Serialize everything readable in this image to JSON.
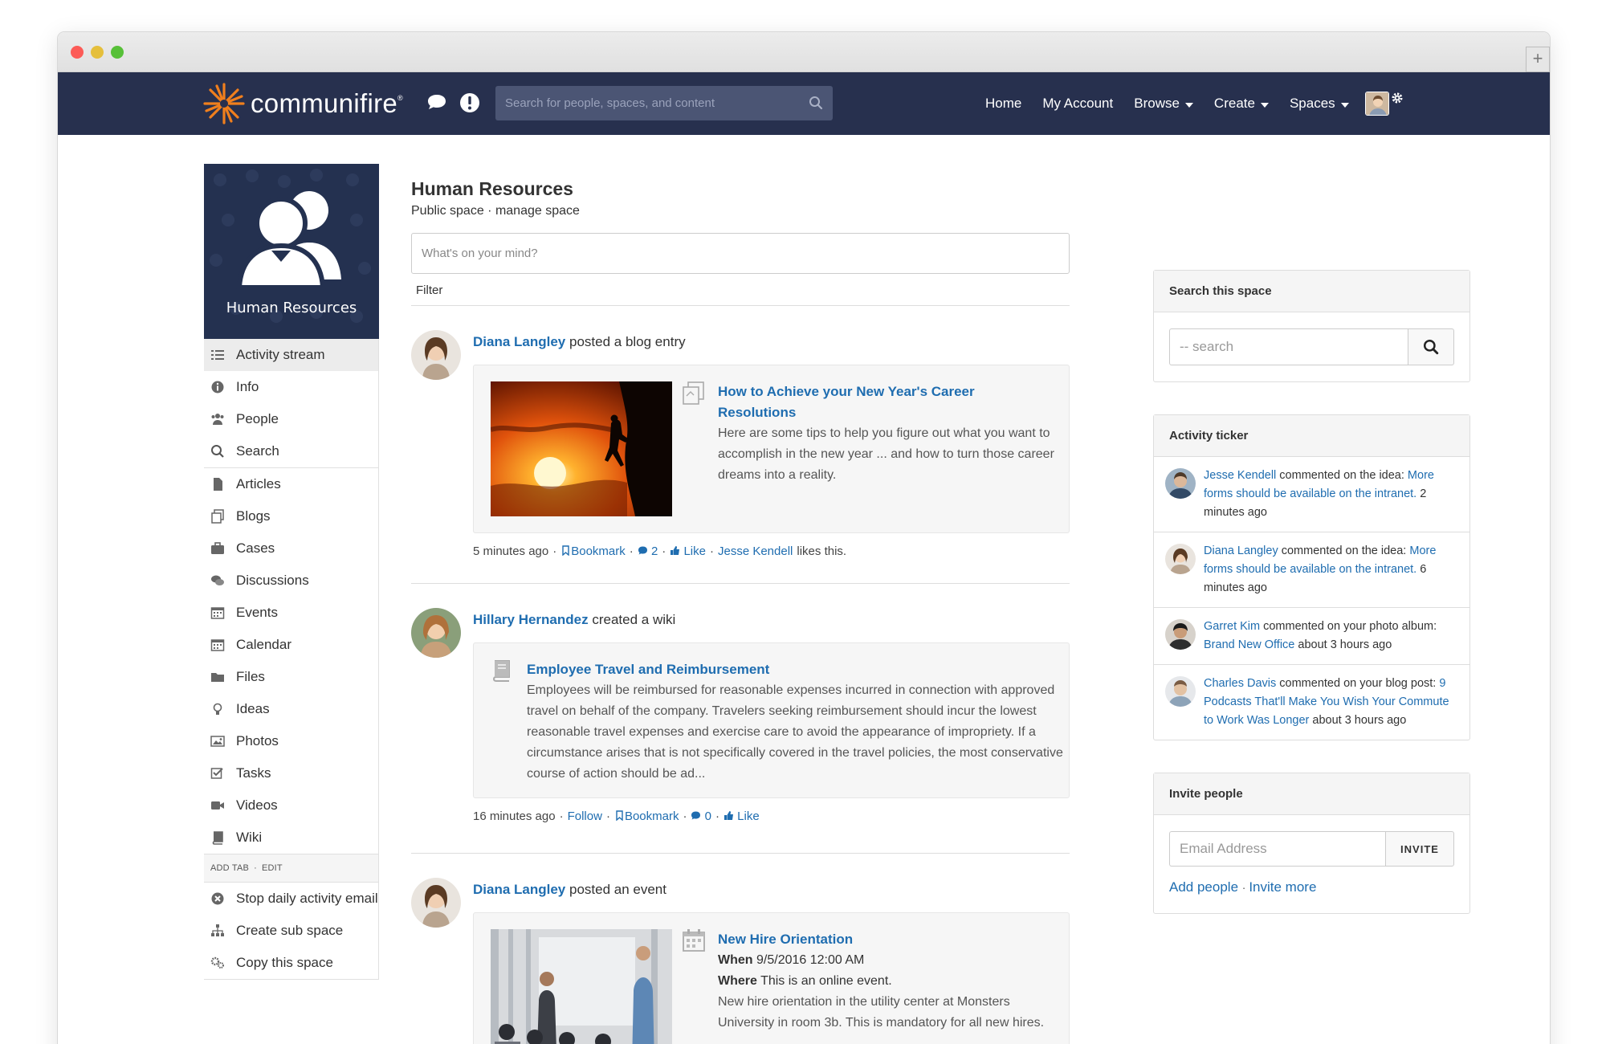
{
  "top_nav": {
    "brand": "communifire",
    "search_placeholder": "Search for people, spaces, and content",
    "menu": [
      {
        "label": "Home",
        "dropdown": false
      },
      {
        "label": "My Account",
        "dropdown": false
      },
      {
        "label": "Browse",
        "dropdown": true
      },
      {
        "label": "Create",
        "dropdown": true
      },
      {
        "label": "Spaces",
        "dropdown": true
      }
    ]
  },
  "space": {
    "tile_label": "Human Resources",
    "title": "Human Resources",
    "subtitle": "Public space · manage space"
  },
  "sidebar": {
    "items": [
      {
        "label": "Activity stream",
        "icon": "list-icon",
        "active": true
      },
      {
        "label": "Info",
        "icon": "info-icon"
      },
      {
        "label": "People",
        "icon": "people-icon"
      },
      {
        "label": "Search",
        "icon": "search-icon"
      },
      {
        "label": "Articles",
        "icon": "document-icon"
      },
      {
        "label": "Blogs",
        "icon": "blog-icon"
      },
      {
        "label": "Cases",
        "icon": "briefcase-icon"
      },
      {
        "label": "Discussions",
        "icon": "comments-icon"
      },
      {
        "label": "Events",
        "icon": "calendar-icon"
      },
      {
        "label": "Calendar",
        "icon": "calendar-icon"
      },
      {
        "label": "Files",
        "icon": "folder-icon"
      },
      {
        "label": "Ideas",
        "icon": "lightbulb-icon"
      },
      {
        "label": "Photos",
        "icon": "image-icon"
      },
      {
        "label": "Tasks",
        "icon": "checkbox-icon"
      },
      {
        "label": "Videos",
        "icon": "video-icon"
      },
      {
        "label": "Wiki",
        "icon": "book-icon"
      }
    ],
    "add_tab": "ADD TAB",
    "edit": "EDIT",
    "actions": [
      {
        "label": "Stop daily activity email",
        "icon": "stop-icon"
      },
      {
        "label": "Create sub space",
        "icon": "sitemap-icon"
      },
      {
        "label": "Copy this space",
        "icon": "gears-icon"
      }
    ]
  },
  "composer": {
    "placeholder": "What's on your mind?",
    "filter_label": "Filter"
  },
  "feed": [
    {
      "author": "Diana Langley",
      "action": "posted a blog entry",
      "title": "How to Achieve your New Year's Career Resolutions",
      "body": "Here are some tips to help you figure out what you want to accomplish in the new year ... and how to turn those career dreams into a reality.",
      "time": "5 minutes ago",
      "bookmark": "Bookmark",
      "comments": "2",
      "like": "Like",
      "liker": "Jesse Kendell",
      "likes_suffix": "likes this."
    },
    {
      "author": "Hillary Hernandez",
      "action": "created a wiki",
      "title": "Employee Travel and Reimbursement",
      "body": "Employees will be reimbursed for reasonable expenses incurred in connection with approved travel on behalf of the company. Travelers seeking reimbursement should incur the lowest reasonable travel expenses and exercise care to avoid the appearance of impropriety. If a circumstance arises that is not specifically covered in the travel policies, the most conservative course of action should be ad...",
      "time": "16 minutes ago",
      "follow": "Follow",
      "bookmark": "Bookmark",
      "comments": "0",
      "like": "Like"
    },
    {
      "author": "Diana Langley",
      "action": "posted an event",
      "title": "New Hire Orientation",
      "when_label": "When",
      "when": "9/5/2016 12:00 AM",
      "where_label": "Where",
      "where": "This is an online event.",
      "body": "New hire orientation in the utility center at Monsters University in room 3b. This is mandatory for all new hires."
    }
  ],
  "right": {
    "search_title": "Search this space",
    "search_placeholder": "-- search",
    "ticker_title": "Activity ticker",
    "ticker": [
      {
        "name": "Jesse Kendell",
        "text": " commented on the idea: ",
        "target": "More forms should be available on the intranet.",
        "time": " 2 minutes ago"
      },
      {
        "name": "Diana Langley",
        "text": " commented on the idea: ",
        "target": "More forms should be available on the intranet.",
        "time": " 6 minutes ago"
      },
      {
        "name": "Garret Kim",
        "text": " commented on your photo album: ",
        "target": "Brand New Office",
        "time": " about 3 hours ago"
      },
      {
        "name": "Charles Davis",
        "text": " commented on your blog post: ",
        "target": "9 Podcasts That'll Make You Wish Your Commute to Work Was Longer",
        "time": " about 3 hours ago"
      }
    ],
    "invite_title": "Invite people",
    "invite_placeholder": "Email Address",
    "invite_button": "INVITE",
    "add_people": "Add people",
    "invite_more": "Invite more"
  },
  "colors": {
    "nav_bg": "#27304e",
    "link": "#1f6db0",
    "brand_orange": "#f07f1d"
  }
}
